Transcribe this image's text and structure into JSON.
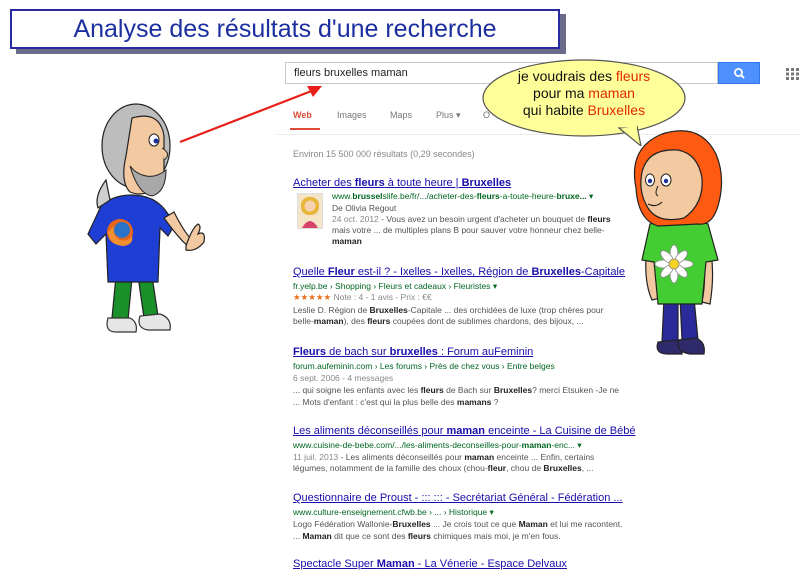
{
  "slide": {
    "title": "Analyse des résultats d'une recherche"
  },
  "search": {
    "query": "fleurs bruxelles maman"
  },
  "tabs": [
    "Web",
    "Images",
    "Maps",
    "Plus ▾",
    "O"
  ],
  "stats": "Environ 15 500 000 résultats (0,29 secondes)",
  "bubble": {
    "line1_pre": "je voudrais des ",
    "line1_hl": "fleurs",
    "line2_pre": "pour ma ",
    "line2_hl": "maman",
    "line3_pre": "qui habite ",
    "line3_hl": "Bruxelles"
  },
  "results": {
    "r1": {
      "title_a": "Acheter des ",
      "title_b": "fleurs",
      "title_c": " à toute heure | ",
      "title_d": "Bruxelles",
      "url_a": "www.",
      "url_b": "brussel",
      "url_c": "slife.be/fr/.../acheter-des-",
      "url_d": "fleurs",
      "url_e": "-a-toute-heure-",
      "url_f": "bruxe...",
      "url_g": " ▾",
      "author": "De Olivia Regout",
      "date": "24 oct. 2012",
      "s1a": " - Vous avez un besoin urgent d'acheter un bouquet de ",
      "s1b": "fleurs",
      "s2": "mais votre ... de multiples plans B pour sauver votre honneur chez belle-",
      "s3": "maman"
    },
    "r2": {
      "title_a": "Quelle ",
      "title_b": "Fleur",
      "title_c": " est-il ? - Ixelles - Ixelles, Région de ",
      "title_d": "Bruxelles",
      "title_e": "-Capitale",
      "url": "fr.yelp.be › Shopping › Fleurs et cadeaux › Fleuristes ▾",
      "stars": "★★★★★",
      "rating": " Note : 4 - 1 avis - Prix : €€",
      "s1a": "Leslie D. Région de ",
      "s1b": "Bruxelles",
      "s1c": "-Capitale ... des orchidées de luxe (trop chères pour",
      "s2a": "belle-",
      "s2b": "maman",
      "s2c": "), des ",
      "s2d": "fleurs",
      "s2e": " coupées dont de sublimes chardons, des bijoux, ..."
    },
    "r3": {
      "title_a": "Fleurs",
      "title_b": " de bach sur ",
      "title_c": "bruxelles",
      "title_d": " : Forum auFeminin",
      "url": "forum.aufeminin.com › Les forums › Près de chez vous › Entre belges",
      "date": "6 sept. 2006 - 4 messages",
      "s1a": "... qui soigne les enfants avec les ",
      "s1b": "fleurs",
      "s1c": " de Bach sur ",
      "s1d": "Bruxelles",
      "s1e": "? merci Etsuken -Je ne",
      "s2a": "... Mots d'enfant : c'est qui la plus belle des ",
      "s2b": "mamans",
      "s2c": " ?"
    },
    "r4": {
      "title_a": "Les aliments déconseillés pour ",
      "title_b": "maman",
      "title_c": " enceinte - La Cuisine de Bébé",
      "url_a": "www.cuisine-de-bebe.com/.../les-aliments-deconseilles-pour-",
      "url_b": "maman",
      "url_c": "-enc... ▾",
      "date": "11 juil. 2013",
      "s1a": " - Les aliments déconseillés pour ",
      "s1b": "maman",
      "s1c": " enceinte ... Enfin, certains",
      "s2a": "légumes, notamment de la famille des choux (chou-",
      "s2b": "fleur",
      "s2c": ", chou de ",
      "s2d": "Bruxelles",
      "s2e": ", ..."
    },
    "r5": {
      "title": "Questionnaire de Proust - ::: ::: - Secrétariat Général - Fédération ...",
      "url": "www.culture-enseignement.cfwb.be › ... › Historique ▾",
      "s1a": "Logo Fédération Wallonie-",
      "s1b": "Bruxelles",
      "s1c": " ... Je crois tout ce que ",
      "s1d": "Maman",
      "s1e": " et lui me racontent.",
      "s2a": "... ",
      "s2b": "Maman",
      "s2c": " dit que ce sont des ",
      "s2d": "fleurs",
      "s2e": " chimiques mais moi, je m'en fous."
    },
    "r6": {
      "title_a": "Spectacle Super ",
      "title_b": "Maman",
      "title_c": " - La Vénerie - Espace Delvaux"
    }
  },
  "colors": {
    "title_text": "#1c2fa0",
    "link": "#1a0dab",
    "url": "#006621",
    "accent_red": "#dd4b39",
    "search_button": "#4d90fe",
    "bubble_fill": "#ffff99"
  },
  "icons": [
    "search-icon",
    "apps-grid-icon",
    "firefox-logo-icon",
    "daisy-flower-icon"
  ]
}
